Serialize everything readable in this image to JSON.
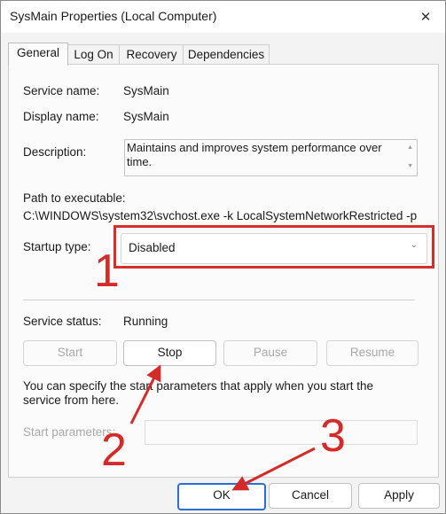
{
  "window": {
    "title": "SysMain Properties (Local Computer)",
    "close_glyph": "✕"
  },
  "tabs": [
    {
      "label": "General",
      "active": true
    },
    {
      "label": "Log On"
    },
    {
      "label": "Recovery"
    },
    {
      "label": "Dependencies"
    }
  ],
  "general": {
    "service_name_label": "Service name:",
    "service_name_value": "SysMain",
    "display_name_label": "Display name:",
    "display_name_value": "SysMain",
    "description_label": "Description:",
    "description_value": "Maintains and improves system performance over time.",
    "path_label": "Path to executable:",
    "path_value": "C:\\WINDOWS\\system32\\svchost.exe -k LocalSystemNetworkRestricted -p",
    "startup_type_label": "Startup type:",
    "startup_type_value": "Disabled",
    "service_status_label": "Service status:",
    "service_status_value": "Running",
    "service_buttons": {
      "start": "Start",
      "stop": "Stop",
      "pause": "Pause",
      "resume": "Resume"
    },
    "start_params_help": "You can specify the start parameters that apply when you start the service from here.",
    "start_params_label": "Start parameters:",
    "start_params_value": ""
  },
  "footer_buttons": {
    "ok": "OK",
    "cancel": "Cancel",
    "apply": "Apply"
  },
  "annotations": {
    "one": "1",
    "two": "2",
    "three": "3",
    "color": "#d42a2a"
  },
  "icons": {
    "close": "close-icon",
    "dropdown": "chevron-down-icon",
    "scroll_up": "scroll-up-icon",
    "scroll_down": "scroll-down-icon"
  }
}
